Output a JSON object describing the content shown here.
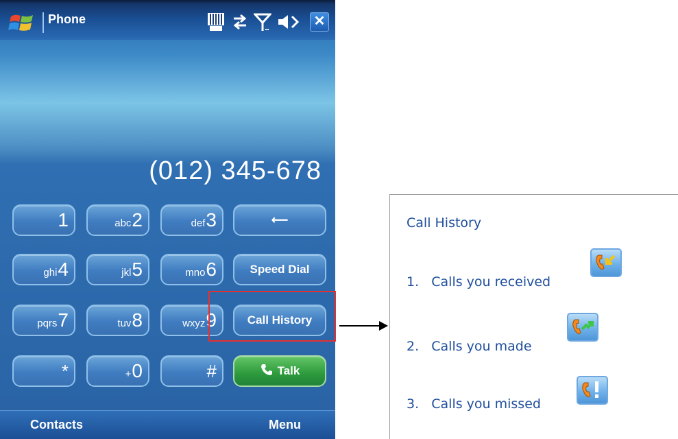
{
  "app": {
    "title": "Phone",
    "close_label": "✕"
  },
  "status_icons": [
    "storage-card-icon",
    "sync-arrows-icon",
    "signal-strength-icon",
    "volume-icon"
  ],
  "display": {
    "number": "(012) 345-678"
  },
  "keypad": {
    "k1": {
      "num": "1",
      "sub": ""
    },
    "k2": {
      "num": "2",
      "sub": "abc"
    },
    "k3": {
      "num": "3",
      "sub": "def"
    },
    "k4": {
      "num": "4",
      "sub": "ghi"
    },
    "k5": {
      "num": "5",
      "sub": "jkl"
    },
    "k6": {
      "num": "6",
      "sub": "mno"
    },
    "k7": {
      "num": "7",
      "sub": "pqrs"
    },
    "k8": {
      "num": "8",
      "sub": "tuv"
    },
    "k9": {
      "num": "9",
      "sub": "wxyz"
    },
    "kstar": {
      "num": "*"
    },
    "k0": {
      "num": "0",
      "sub": "+"
    },
    "khash": {
      "num": "#"
    },
    "backspace": "⟵",
    "speed_dial": "Speed Dial",
    "call_history": "Call History",
    "talk": "Talk"
  },
  "softkeys": {
    "left": "Contacts",
    "right": "Menu"
  },
  "legend": {
    "title": "Call History",
    "items": [
      {
        "num": "1.",
        "text": "Calls you received",
        "icon": "call-received-icon"
      },
      {
        "num": "2.",
        "text": "Calls you made",
        "icon": "call-made-icon"
      },
      {
        "num": "3.",
        "text": "Calls you missed",
        "icon": "call-missed-icon"
      }
    ]
  },
  "colors": {
    "accent_text": "#1f4e9c",
    "highlight": "#e53030",
    "talk_green": "#2c9a3c"
  }
}
